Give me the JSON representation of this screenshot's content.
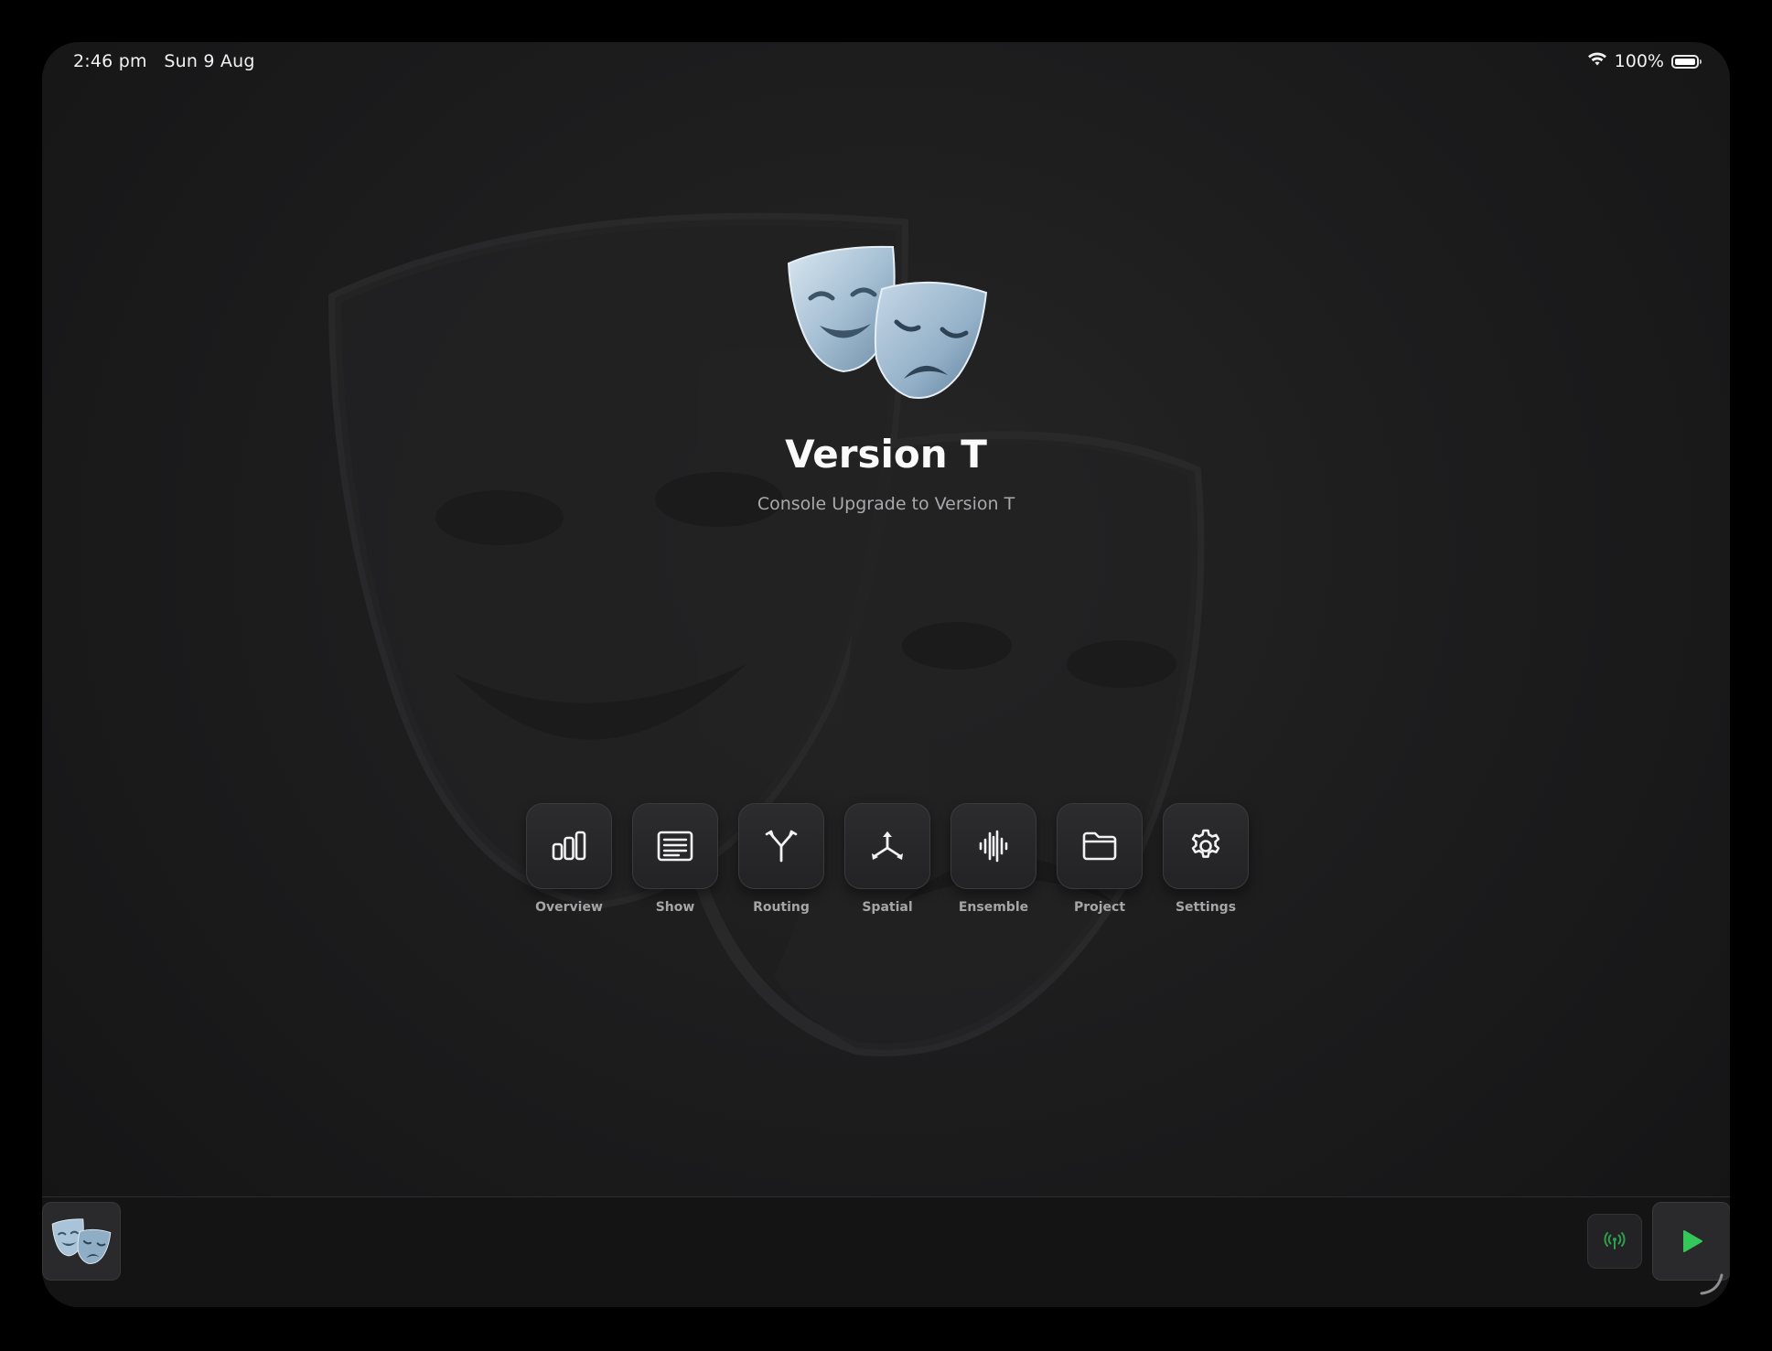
{
  "status_bar": {
    "time": "2:46 pm",
    "date": "Sun 9 Aug",
    "battery_percent": "100%",
    "battery_level": 1.0,
    "wifi_icon": "wifi-icon"
  },
  "app": {
    "title": "Version T",
    "subtitle": "Console Upgrade to Version T",
    "icon": "theater-masks-icon"
  },
  "nav": {
    "items": [
      {
        "label": "Overview",
        "icon": "bar-chart-icon"
      },
      {
        "label": "Show",
        "icon": "list-icon"
      },
      {
        "label": "Routing",
        "icon": "routing-fork-icon"
      },
      {
        "label": "Spatial",
        "icon": "spatial-axes-icon"
      },
      {
        "label": "Ensemble",
        "icon": "waveform-icon"
      },
      {
        "label": "Project",
        "icon": "folder-icon"
      },
      {
        "label": "Settings",
        "icon": "gear-icon"
      }
    ]
  },
  "bottom_bar": {
    "app_icon": "theater-masks-icon",
    "broadcast_icon": "broadcast-icon",
    "play_icon": "play-icon"
  },
  "colors": {
    "background": "#1d1d1e",
    "tile": "#2a2a2c",
    "label": "#a6a6a8",
    "accent_green": "#34c759",
    "mask_blue": "#a9c4d8"
  }
}
